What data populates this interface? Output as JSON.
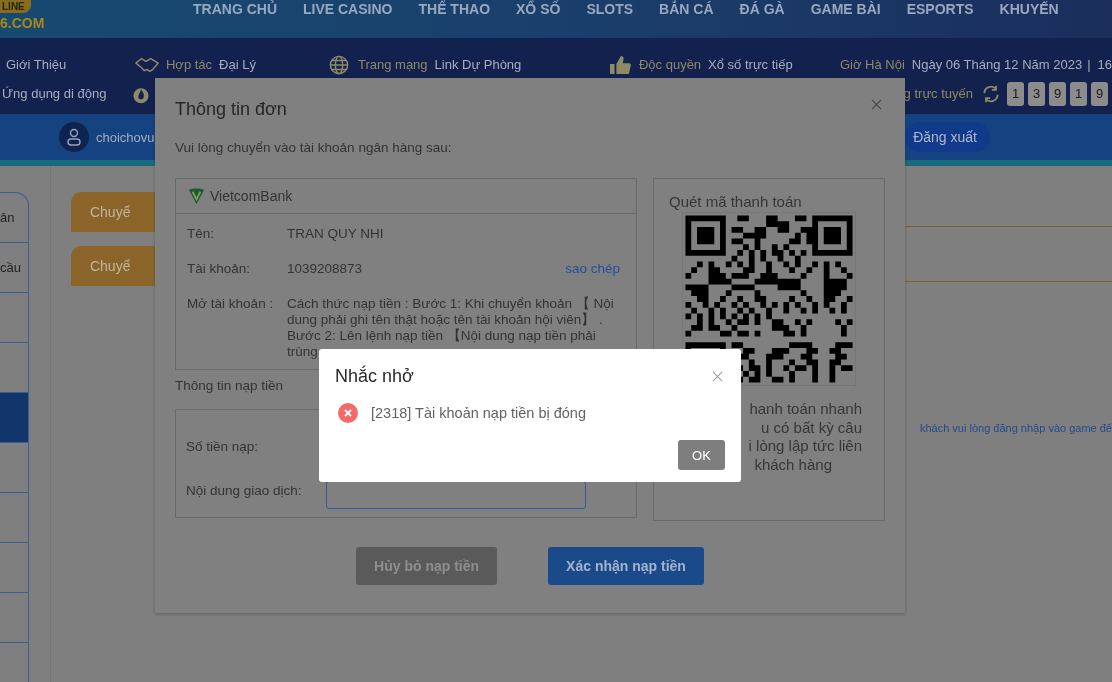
{
  "header": {
    "logo": {
      "ribbon": "LINE",
      "domain": "6.COM"
    },
    "nav": [
      "TRANG CHỦ",
      "LIVE CASINO",
      "THỂ THAO",
      "XỔ SỐ",
      "SLOTS",
      "BẮN CÁ",
      "ĐÁ GÀ",
      "GAME BÀI",
      "ESPORTS",
      "KHUYẾN"
    ]
  },
  "info_bar": {
    "row1": [
      {
        "text": "Giới Thiệu"
      },
      {
        "label": "Hợp tác",
        "text": "Đại Lý"
      },
      {
        "label": "Trang mạng",
        "text": "Link Dự Phòng"
      },
      {
        "label": "Độc quyền",
        "text": "Xổ số trực tiếp"
      },
      {
        "label": "Giờ Hà Nội",
        "text": "Ngày 06 Tháng 12 Năm 2023",
        "separator": "|",
        "time": "16"
      }
    ],
    "row2": {
      "app": "Ứng dụng di động",
      "online_label": "g trực tuyến",
      "digits": [
        "1",
        "3",
        "9",
        "1",
        "9"
      ]
    }
  },
  "user_bar": {
    "username": "choichovu",
    "logout": "Đăng xuất"
  },
  "sidebar": {
    "items": [
      {
        "text": "ân",
        "selected": false
      },
      {
        "text": "cầu",
        "selected": false
      },
      {
        "selected": false
      },
      {
        "selected": false
      },
      {
        "selected": true
      },
      {
        "selected": false
      },
      {
        "selected": false
      },
      {
        "selected": false
      },
      {
        "selected": false
      }
    ]
  },
  "content": {
    "tabs": [
      "Chuyể",
      "Chuyể"
    ],
    "notice": "khách vui lòng đăng nhập vào game để"
  },
  "order_modal": {
    "title": "Thông tin đơn",
    "intro": "Vui lòng chuyển vào tài khoản ngân hàng sau:",
    "bank": {
      "name": "VietcomBank",
      "fields": [
        {
          "label": "Tên:",
          "value": "TRAN QUY NHI"
        },
        {
          "label": "Tài khoản:",
          "value": "1039208873",
          "action": "sao chép"
        },
        {
          "label": "Mở tài khoản :",
          "value": "Cách thức nạp tiền : Bước 1: Khi chuyển khoản 【 Nội dung phải ghi tên thật hoặc tên tài khoản hội viên】 . Bước 2: Lên lệnh nạp tiền 【Nội dung nạp tiền phải trùng"
        }
      ]
    },
    "qr": {
      "title": "Quét mã thanh toán",
      "note_lines": [
        "hanh toán nhanh",
        "u có bất kỳ câu",
        "i lòng lập tức liên",
        "khách hàng"
      ]
    },
    "deposit": {
      "title": "Thông tin nạp tiền",
      "fields": [
        {
          "label": "Số tiền nạp:"
        },
        {
          "label": "Nội dung giao dịch:"
        }
      ]
    },
    "buttons": [
      {
        "kind": "cancel",
        "label": "Hủy bỏ nạp tiền"
      },
      {
        "kind": "confirm",
        "label": "Xác nhận nạp tiền"
      }
    ]
  },
  "alert": {
    "title": "Nhắc nhở",
    "kind": "error",
    "message": "[2318] Tài khoản nạp tiền bị đóng",
    "button": "OK"
  }
}
